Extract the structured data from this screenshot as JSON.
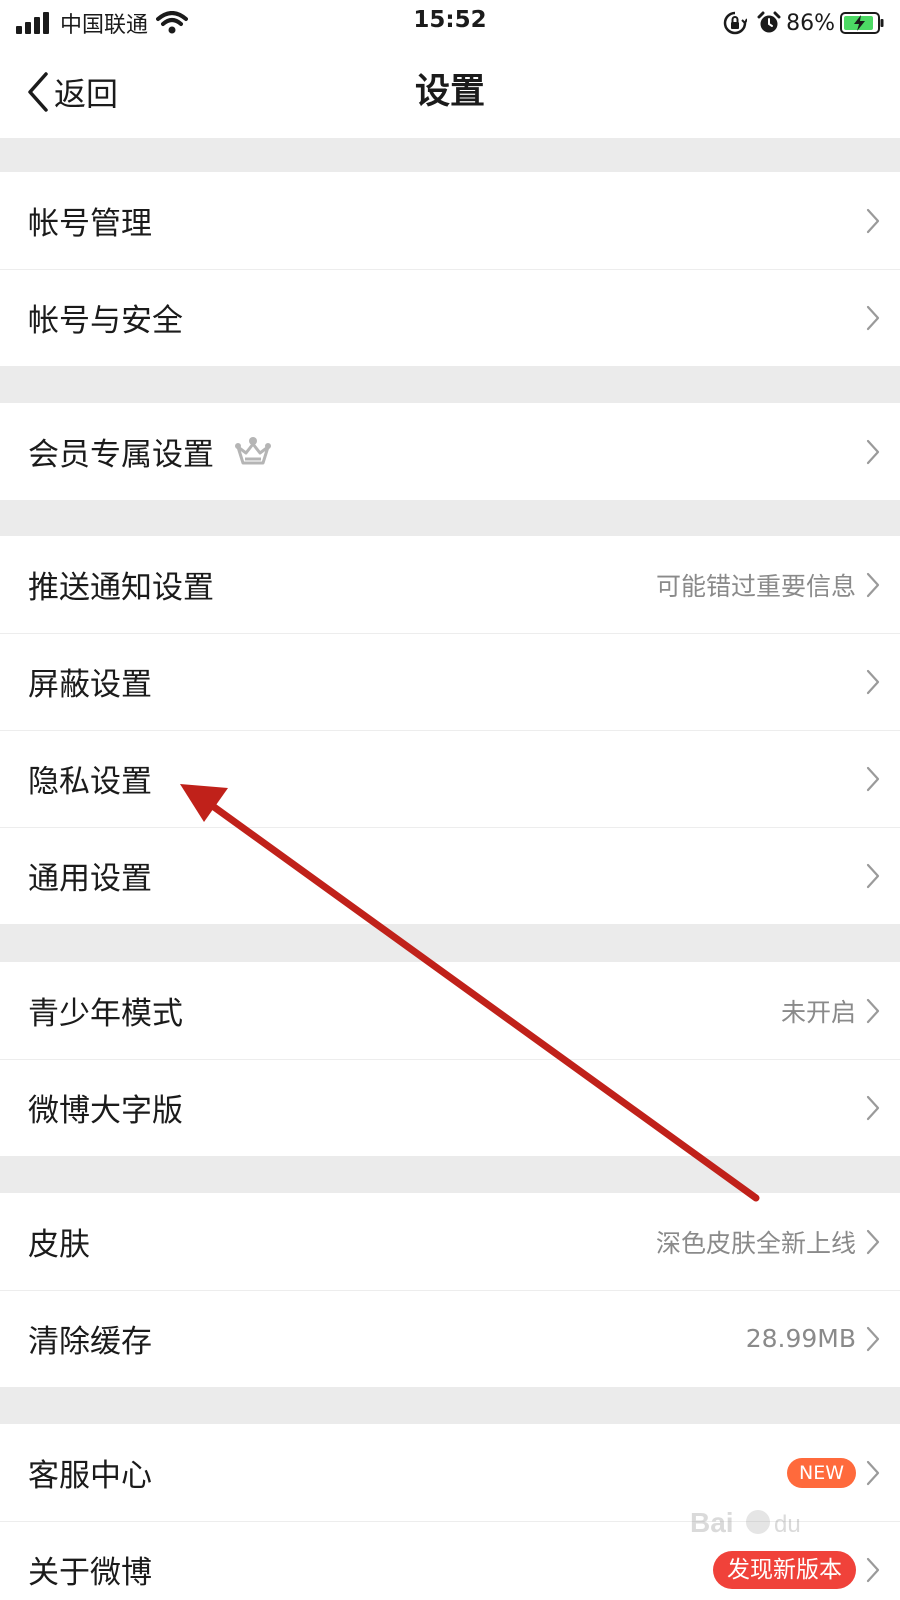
{
  "status_bar": {
    "carrier": "中国联通",
    "time": "15:52",
    "battery_percent": "86%",
    "icons": [
      "signal-icon",
      "wifi-icon",
      "orientation-lock-icon",
      "alarm-icon",
      "battery-charging-icon"
    ]
  },
  "nav": {
    "back_label": "返回",
    "title": "设置"
  },
  "groups": [
    {
      "items": [
        {
          "label": "帐号管理",
          "value": ""
        },
        {
          "label": "帐号与安全",
          "value": ""
        }
      ]
    },
    {
      "items": [
        {
          "label": "会员专属设置",
          "value": "",
          "icon": "crown-icon"
        }
      ]
    },
    {
      "items": [
        {
          "label": "推送通知设置",
          "value": "可能错过重要信息"
        },
        {
          "label": "屏蔽设置",
          "value": ""
        },
        {
          "label": "隐私设置",
          "value": ""
        },
        {
          "label": "通用设置",
          "value": ""
        }
      ]
    },
    {
      "items": [
        {
          "label": "青少年模式",
          "value": "未开启"
        },
        {
          "label": "微博大字版",
          "value": ""
        }
      ]
    },
    {
      "items": [
        {
          "label": "皮肤",
          "value": "深色皮肤全新上线"
        },
        {
          "label": "清除缓存",
          "value": "28.99MB"
        }
      ]
    },
    {
      "items": [
        {
          "label": "客服中心",
          "badge": "NEW"
        },
        {
          "label": "关于微博",
          "badge": "发现新版本"
        }
      ]
    }
  ],
  "colors": {
    "background": "#ebebeb",
    "row_background": "#ffffff",
    "value_text": "#8a8a8a",
    "new_badge": "#ff6a3c",
    "update_badge": "#f0423a",
    "annotation_arrow": "#c0211a"
  }
}
